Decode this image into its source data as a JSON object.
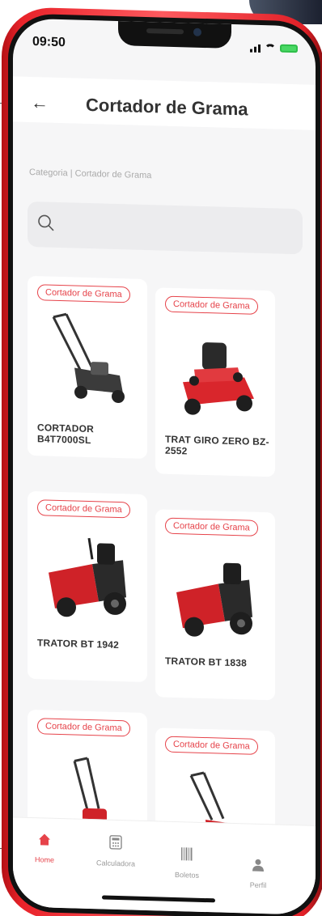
{
  "status_bar": {
    "time": "09:50"
  },
  "header": {
    "title": "Cortador de Grama"
  },
  "breadcrumb": "Categoria | Cortador de Grama",
  "search": {
    "placeholder": ""
  },
  "products": [
    {
      "tag": "Cortador de Grama",
      "name": "CORTADOR B4T7000SL",
      "image": "push-lawn-mower"
    },
    {
      "tag": "Cortador de Grama",
      "name": "TRAT GIRO ZERO BZ-2552",
      "image": "zero-turn-tractor"
    },
    {
      "tag": "Cortador de Grama",
      "name": "TRATOR BT 1942",
      "image": "riding-tractor"
    },
    {
      "tag": "Cortador de Grama",
      "name": "TRATOR BT 1838",
      "image": "riding-tractor"
    },
    {
      "tag": "Cortador de Grama",
      "name": "",
      "image": "push-lawn-mower"
    },
    {
      "tag": "Cortador de Grama",
      "name": "",
      "image": "push-lawn-mower-red"
    }
  ],
  "tabs": [
    {
      "label": "Home",
      "icon": "home-icon",
      "active": true
    },
    {
      "label": "Calculadora",
      "icon": "calculator-icon",
      "active": false
    },
    {
      "label": "Boletos",
      "icon": "barcode-icon",
      "active": false
    },
    {
      "label": "Perfil",
      "icon": "user-icon",
      "active": false
    }
  ],
  "colors": {
    "accent": "#e6434a",
    "phone_body": "#e8232a"
  }
}
